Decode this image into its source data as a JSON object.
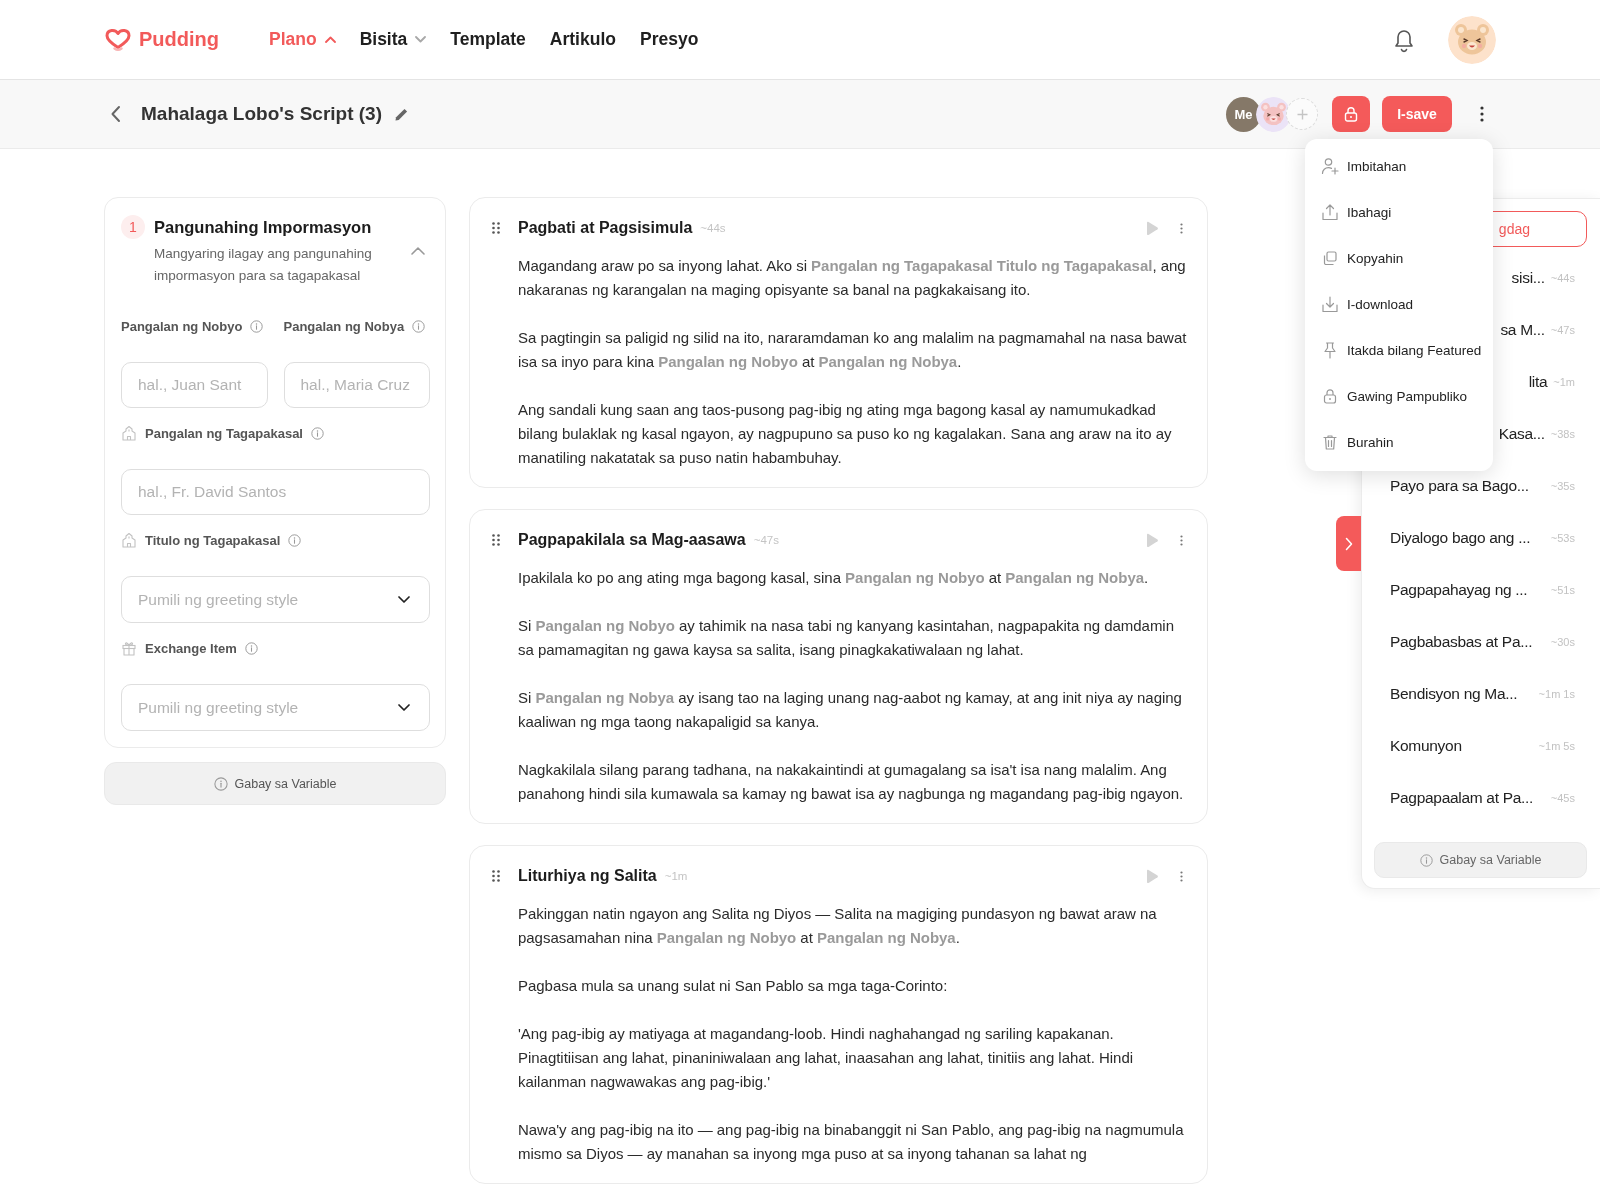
{
  "header": {
    "logo": "Pudding",
    "nav": [
      {
        "label": "Plano",
        "kind": "dropdown",
        "selected": true
      },
      {
        "label": "Bisita",
        "kind": "dropdown",
        "selected": false
      },
      {
        "label": "Template",
        "kind": "link",
        "selected": false
      },
      {
        "label": "Artikulo",
        "kind": "link",
        "selected": false
      },
      {
        "label": "Presyo",
        "kind": "link",
        "selected": false
      }
    ]
  },
  "toolbar": {
    "title": "Mahalaga Lobo's Script (3)",
    "collaborators": [
      {
        "kind": "initials",
        "label": "Me"
      },
      {
        "kind": "avatar"
      }
    ],
    "save_button": "I-save"
  },
  "menu": {
    "items": [
      {
        "label": "Imbitahan"
      },
      {
        "label": "Ibahagi"
      },
      {
        "label": "Kopyahin"
      },
      {
        "label": "I-download"
      },
      {
        "label": "Itakda bilang Featured"
      },
      {
        "label": "Gawing Pampubliko"
      },
      {
        "label": "Burahin"
      }
    ]
  },
  "form": {
    "step": "1",
    "title": "Pangunahing Impormasyon",
    "description": "Mangyaring ilagay ang pangunahing impormasyon para sa tagapakasal",
    "expanded": true,
    "name_fields": [
      {
        "label": "Pangalan ng Nobyo",
        "placeholder": "hal., Juan Sant"
      },
      {
        "label": "Pangalan ng Nobya",
        "placeholder": "hal., Maria Cruz"
      }
    ],
    "fields": [
      {
        "label": "Pangalan ng Tagapakasal",
        "kind": "text",
        "placeholder": "hal., Fr. David Santos"
      },
      {
        "label": "Titulo ng Tagapakasal",
        "kind": "select",
        "placeholder": "Pumili ng greeting style"
      },
      {
        "label": "Exchange Item",
        "kind": "select",
        "placeholder": "Pumili ng greeting style"
      }
    ],
    "guide_button": "Gabay sa Variable"
  },
  "sections": [
    {
      "title": "Pagbati at Pagsisimula",
      "duration": "~44s",
      "paragraphs": [
        "Magandang araw po sa inyong lahat. Ako si **Pangalan ng Tagapakasal** **Titulo ng Tagapakasal**, ang nakaranas ng karangalan na maging opisyante sa banal na pagkakaisang ito.",
        "Sa pagtingin sa paligid ng silid na ito, nararamdaman ko ang malalim na pagmamahal na nasa bawat isa sa inyo para kina **Pangalan ng Nobyo** at **Pangalan ng Nobya**.",
        "Ang sandali kung saan ang taos-pusong pag-ibig ng ating mga bagong kasal ay namumukadkad bilang bulaklak ng kasal ngayon, ay nagpupuno sa puso ko ng kagalakan. Sana ang araw na ito ay manatiling nakatatak sa puso natin habambuhay."
      ]
    },
    {
      "title": "Pagpapakilala sa Mag-aasawa",
      "duration": "~47s",
      "paragraphs": [
        "Ipakilala ko po ang ating mga bagong kasal, sina **Pangalan ng Nobyo** at **Pangalan ng Nobya**.",
        "Si **Pangalan ng Nobyo** ay tahimik na nasa tabi ng kanyang kasintahan, nagpapakita ng damdamin sa pamamagitan ng gawa kaysa sa salita, isang pinagkakatiwalaan ng lahat.",
        "Si **Pangalan ng Nobya** ay isang tao na laging unang nag-aabot ng kamay, at ang init niya ay naging kaaliwan ng mga taong nakapaligid sa kanya.",
        "Nagkakilala silang parang tadhana, na nakakaintindi at gumagalang sa isa't isa nang malalim. Ang panahong hindi sila kumawala sa kamay ng bawat isa ay nagbunga ng magandang pag-ibig ngayon."
      ]
    },
    {
      "title": "Liturhiya ng Salita",
      "duration": "~1m",
      "paragraphs": [
        "Pakinggan natin ngayon ang Salita ng Diyos — Salita na magiging pundasyon ng bawat araw na pagsasamahan nina **Pangalan ng Nobyo** at **Pangalan ng Nobya**.",
        "Pagbasa mula sa unang sulat ni San Pablo sa mga taga-Corinto:",
        "'Ang pag-ibig ay matiyaga at magandang-loob. Hindi naghahangad ng sariling kapakanan. Pinagtitiisan ang lahat, pinaniniwalaan ang lahat, inaasahan ang lahat, tinitiis ang lahat. Hindi kailanman nagwawakas ang pag-ibig.'",
        "Nawa'y ang pag-ibig na ito — ang pag-ibig na binabanggit ni San Pablo, ang pag-ibig na nagmumula mismo sa Diyos — ay manahan sa inyong mga puso at sa inyong tahanan sa lahat ng"
      ]
    }
  ],
  "outline": {
    "add_button": "gdag",
    "items_behind_menu": [
      {
        "label": "sisi...",
        "duration": "~44s"
      },
      {
        "label": "sa M...",
        "duration": "~47s"
      },
      {
        "label": "lita",
        "duration": "~1m"
      },
      {
        "label": "Kasa...",
        "duration": "~38s"
      }
    ],
    "items": [
      {
        "label": "Payo para sa Bago...",
        "duration": "~35s"
      },
      {
        "label": "Diyalogo bago ang ...",
        "duration": "~53s"
      },
      {
        "label": "Pagpapahayag ng ...",
        "duration": "~51s"
      },
      {
        "label": "Pagbabasbas at Pa...",
        "duration": "~30s"
      },
      {
        "label": "Bendisyon ng Ma...",
        "duration": "~1m 1s"
      },
      {
        "label": "Komunyon",
        "duration": "~1m 5s"
      },
      {
        "label": "Pagpapaalam at Pa...",
        "duration": "~45s"
      }
    ],
    "guide_button": "Gabay sa Variable"
  }
}
